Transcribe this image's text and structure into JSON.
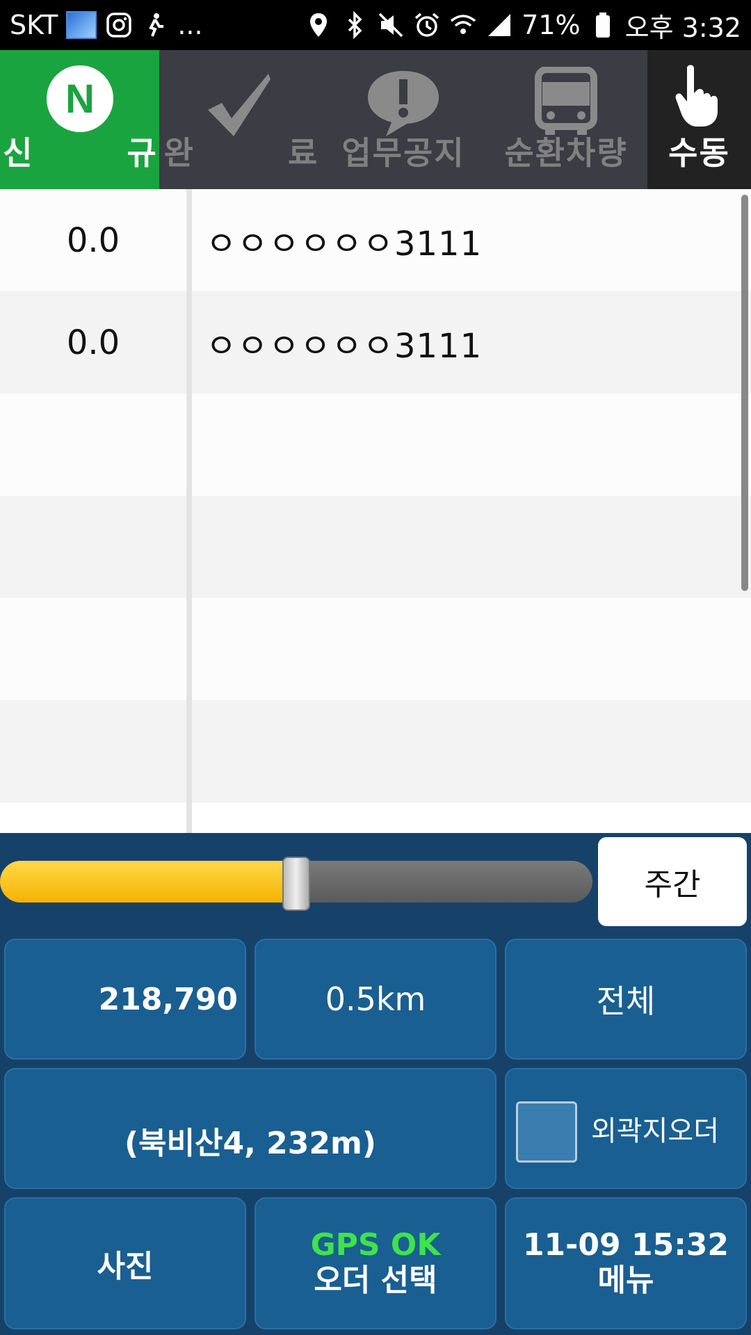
{
  "status_bar": {
    "carrier": "SKT",
    "more": "...",
    "battery": "71%",
    "time": "오후 3:32"
  },
  "tabs": [
    {
      "label": "신 규",
      "icon": "new-n-icon"
    },
    {
      "label": "완 료",
      "icon": "checkmark-icon"
    },
    {
      "label": "업무공지",
      "icon": "notice-exclamation-icon"
    },
    {
      "label": "순환차량",
      "icon": "bus-icon"
    },
    {
      "label": "수동",
      "icon": "hand-pointer-icon"
    }
  ],
  "list": {
    "rows": [
      {
        "left": "0.0",
        "right": "ㅇㅇㅇㅇㅇㅇ3111"
      },
      {
        "left": "0.0",
        "right": "ㅇㅇㅇㅇㅇㅇ3111"
      },
      {
        "left": "",
        "right": ""
      },
      {
        "left": "",
        "right": ""
      },
      {
        "left": "",
        "right": ""
      },
      {
        "left": "",
        "right": ""
      }
    ]
  },
  "panel": {
    "slider_level": 0.5,
    "day_mode": "주간",
    "amount": "218,790",
    "distance": "0.5km",
    "filter": "전체",
    "location": "(북비산4, 232m)",
    "outer_order": "외곽지오더",
    "photo": "사진",
    "gps_status": "GPS OK",
    "order_select": "오더 선택",
    "datetime": "11-09 15:32",
    "menu": "메뉴"
  },
  "colors": {
    "tab_active": "#1aa43f",
    "tab_inactive": "#3b3c44",
    "panel_bg": "#16426a",
    "button_bg": "#1a5f92",
    "gps_ok": "#3ee34a",
    "slider_fill": "#f5b300"
  }
}
